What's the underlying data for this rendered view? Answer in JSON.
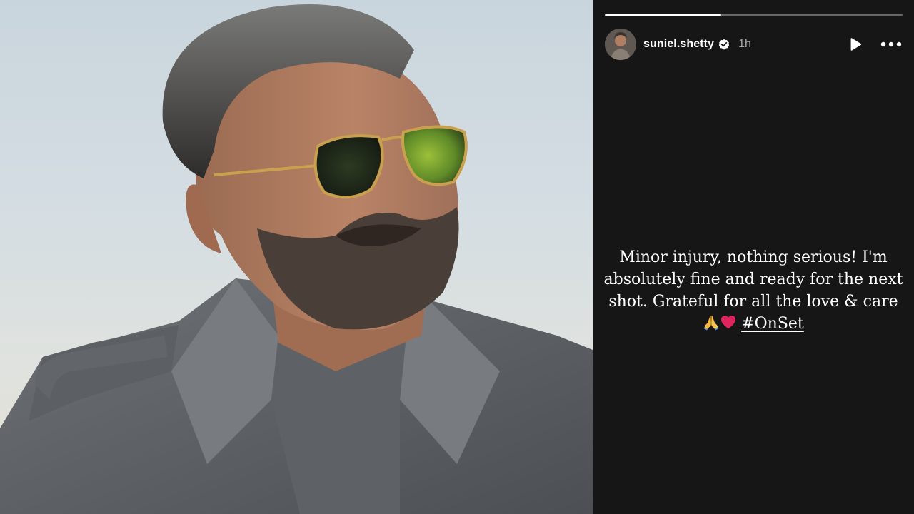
{
  "story": {
    "progress": 0.39,
    "username": "suniel.shetty",
    "time_ago": "1h",
    "caption_lines": [
      "Minor injury, nothing serious! I'm",
      "absolutely fine and ready for the next",
      "shot. Grateful for all the love & care"
    ],
    "hashtag": "#OnSet"
  },
  "icons": {
    "verified": "verified-badge-icon",
    "play": "play-icon",
    "more": "more-options-icon",
    "pray": "folded-hands-emoji",
    "heart": "red-heart-emoji"
  },
  "colors": {
    "story_background": "#161616",
    "text": "#ffffff",
    "muted_text": "#a8a8a8",
    "heart": "#e0245e"
  }
}
